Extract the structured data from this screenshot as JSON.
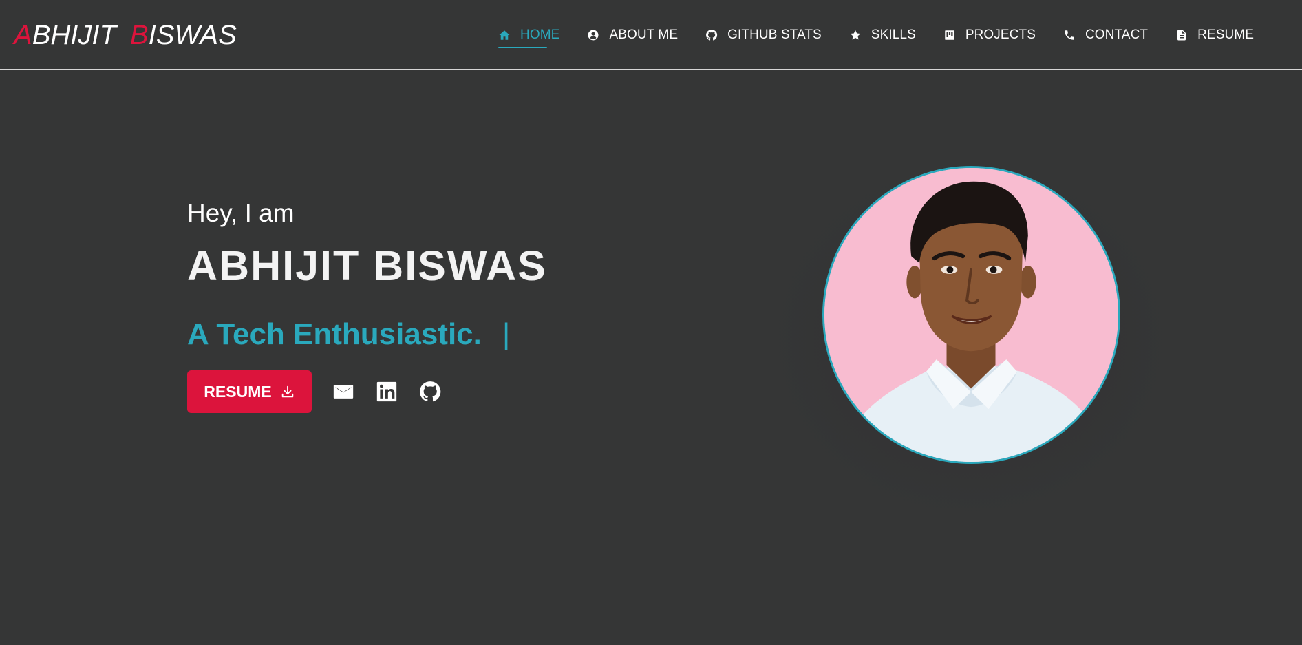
{
  "brand": {
    "first_initial": "A",
    "first_rest": "BHIJIT",
    "last_initial": "B",
    "last_rest": "ISWAS"
  },
  "nav": {
    "items": [
      {
        "label": "HOME",
        "icon": "home-icon",
        "active": true
      },
      {
        "label": "ABOUT ME",
        "icon": "user-circle-icon",
        "active": false
      },
      {
        "label": "GITHUB STATS",
        "icon": "github-icon",
        "active": false
      },
      {
        "label": "SKILLS",
        "icon": "star-icon",
        "active": false
      },
      {
        "label": "PROJECTS",
        "icon": "kanban-icon",
        "active": false
      },
      {
        "label": "CONTACT",
        "icon": "phone-icon",
        "active": false
      },
      {
        "label": "RESUME",
        "icon": "document-icon",
        "active": false
      }
    ]
  },
  "hero": {
    "greeting": "Hey, I am",
    "name": "ABHIJIT BISWAS",
    "tagline": "A Tech Enthusiastic.",
    "cursor": "|",
    "resume_button": "RESUME",
    "socials": [
      {
        "icon": "mail-icon"
      },
      {
        "icon": "linkedin-icon"
      },
      {
        "icon": "github-icon"
      }
    ]
  },
  "colors": {
    "background": "#353636",
    "accent": "#2aa9bd",
    "brand_red": "#dc143c",
    "photo_background": "#f8bcd0"
  }
}
